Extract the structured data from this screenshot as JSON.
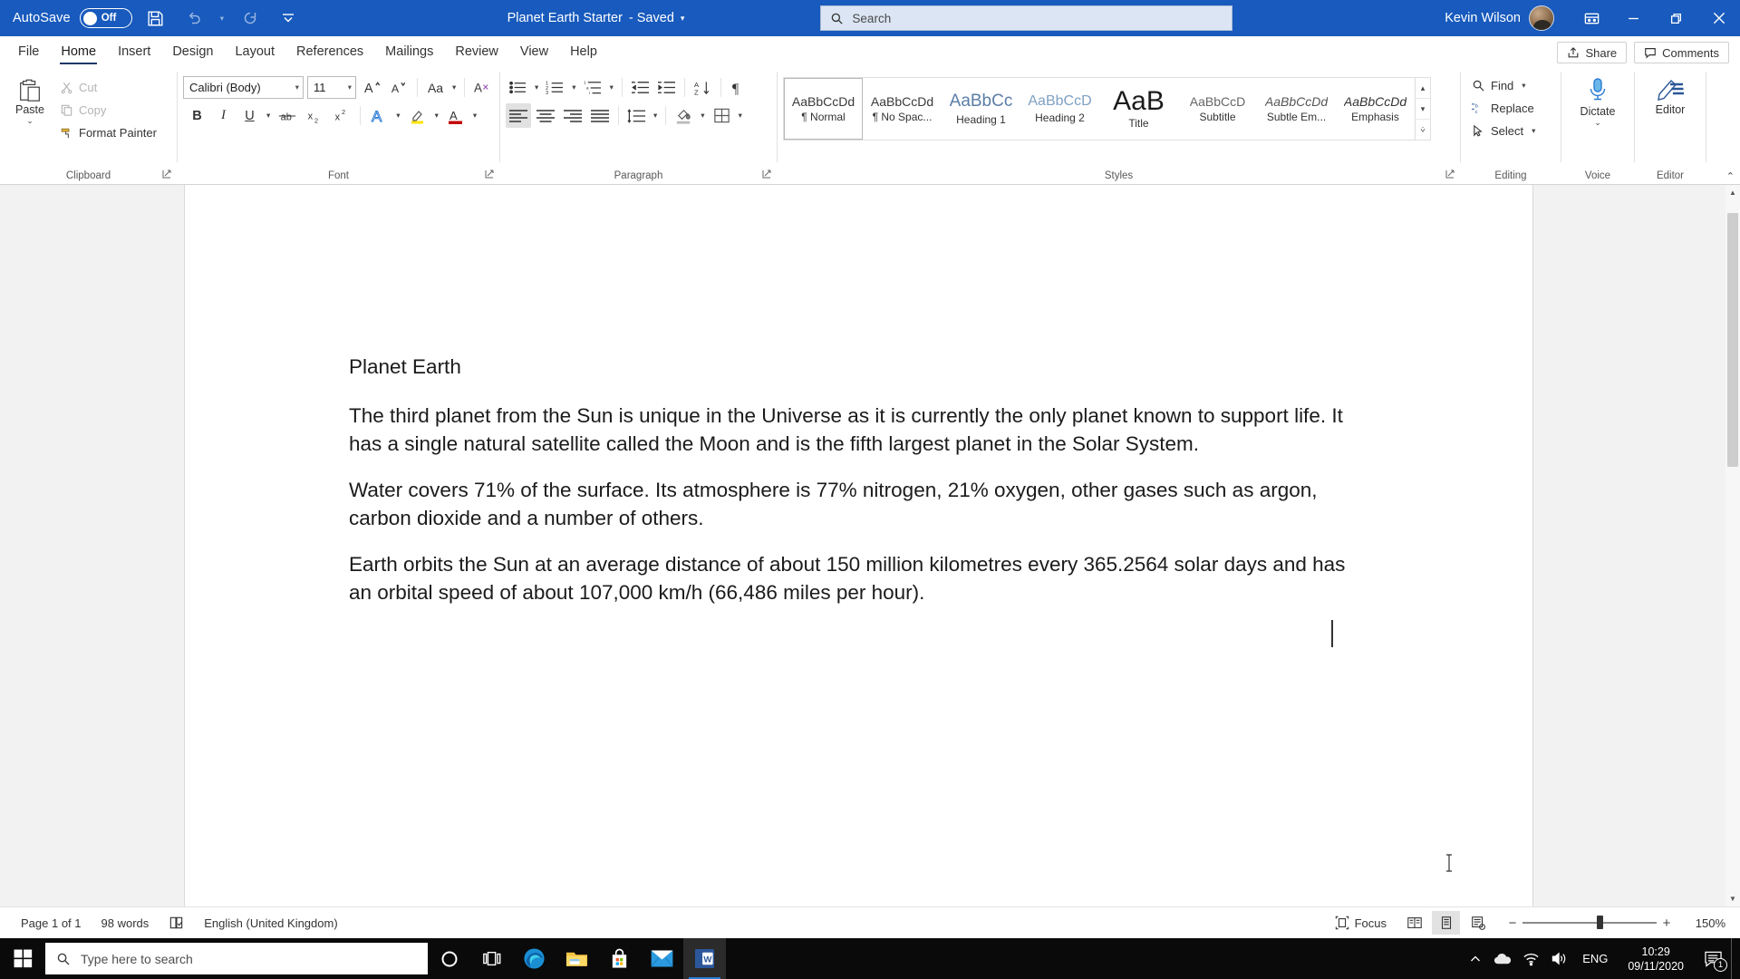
{
  "titlebar": {
    "autosave_label": "AutoSave",
    "autosave_state": "Off",
    "save_icon": "save-icon",
    "undo_icon": "undo-icon",
    "redo_icon": "redo-icon",
    "customize_qat_icon": "customize-quick-access-toolbar-icon",
    "document_title": "Planet Earth Starter",
    "document_status": "- Saved",
    "title_caret_icon": "chevron-down-icon",
    "user_name": "Kevin Wilson",
    "ribbon_display_icon": "ribbon-display-options-icon",
    "minimize_icon": "minimize-icon",
    "restore_icon": "restore-icon",
    "close_icon": "close-icon",
    "accent_color": "#185ABD"
  },
  "search": {
    "placeholder": "Search",
    "icon": "search-icon",
    "value": ""
  },
  "tabs": [
    {
      "label": "File",
      "active": false
    },
    {
      "label": "Home",
      "active": true
    },
    {
      "label": "Insert",
      "active": false
    },
    {
      "label": "Design",
      "active": false
    },
    {
      "label": "Layout",
      "active": false
    },
    {
      "label": "References",
      "active": false
    },
    {
      "label": "Mailings",
      "active": false
    },
    {
      "label": "Review",
      "active": false
    },
    {
      "label": "View",
      "active": false
    },
    {
      "label": "Help",
      "active": false
    }
  ],
  "tabstrip_right": {
    "share_label": "Share",
    "share_icon": "share-icon",
    "comments_label": "Comments",
    "comments_icon": "comment-icon"
  },
  "ribbon": {
    "clipboard": {
      "group_label": "Clipboard",
      "paste_label": "Paste",
      "paste_icon": "paste-icon",
      "cut_label": "Cut",
      "cut_icon": "scissors-icon",
      "copy_label": "Copy",
      "copy_icon": "copy-icon",
      "format_painter_label": "Format Painter",
      "format_painter_icon": "format-painter-icon",
      "dialog_launcher_icon": "dialog-launcher-icon"
    },
    "font": {
      "group_label": "Font",
      "font_name": "Calibri (Body)",
      "font_size": "11",
      "grow_font_icon": "grow-font-icon",
      "shrink_font_icon": "shrink-font-icon",
      "change_case_label": "Aa",
      "change_case_icon": "change-case-icon",
      "clear_formatting_icon": "clear-formatting-icon",
      "bold_label": "B",
      "italic_label": "I",
      "underline_label": "U",
      "strikethrough_icon": "strikethrough-icon",
      "subscript_label": "x",
      "superscript_label": "x",
      "text_effects_icon": "text-effects-icon",
      "highlight_icon": "text-highlight-color-icon",
      "font_color_icon": "font-color-icon",
      "dialog_launcher_icon": "dialog-launcher-icon"
    },
    "paragraph": {
      "group_label": "Paragraph",
      "bullets_icon": "bullets-icon",
      "numbering_icon": "numbering-icon",
      "multilevel_icon": "multilevel-list-icon",
      "decrease_indent_icon": "decrease-indent-icon",
      "increase_indent_icon": "increase-indent-icon",
      "sort_icon": "sort-icon",
      "show_marks_icon": "show-formatting-marks-icon",
      "align_left_icon": "align-left-icon",
      "align_center_icon": "align-center-icon",
      "align_right_icon": "align-right-icon",
      "justify_icon": "justify-icon",
      "line_spacing_icon": "line-spacing-icon",
      "shading_icon": "shading-icon",
      "borders_icon": "borders-icon",
      "dialog_launcher_icon": "dialog-launcher-icon"
    },
    "styles": {
      "group_label": "Styles",
      "dialog_launcher_icon": "dialog-launcher-icon",
      "scroll_up_icon": "chevron-up-icon",
      "scroll_down_icon": "chevron-down-icon",
      "more_icon": "more-styles-icon",
      "items": [
        {
          "preview": "AaBbCcDd",
          "name": "¶ Normal",
          "selected": true,
          "size": "14px",
          "color": "#3a3a3a",
          "style": "normal",
          "weight": "normal"
        },
        {
          "preview": "AaBbCcDd",
          "name": "¶ No Spac...",
          "selected": false,
          "size": "14px",
          "color": "#3a3a3a",
          "style": "normal",
          "weight": "normal"
        },
        {
          "preview": "AaBbCc",
          "name": "Heading 1",
          "selected": false,
          "size": "19px",
          "color": "#5b7da6",
          "style": "normal",
          "weight": "normal"
        },
        {
          "preview": "AaBbCcD",
          "name": "Heading 2",
          "selected": false,
          "size": "16px",
          "color": "#7fa0c2",
          "style": "normal",
          "weight": "normal"
        },
        {
          "preview": "AaB",
          "name": "Title",
          "selected": false,
          "size": "30px",
          "color": "#1b1b1b",
          "style": "normal",
          "weight": "normal"
        },
        {
          "preview": "AaBbCcD",
          "name": "Subtitle",
          "selected": false,
          "size": "14px",
          "color": "#666666",
          "style": "normal",
          "weight": "normal"
        },
        {
          "preview": "AaBbCcDd",
          "name": "Subtle Em...",
          "selected": false,
          "size": "14px",
          "color": "#555555",
          "style": "italic",
          "weight": "normal"
        },
        {
          "preview": "AaBbCcDd",
          "name": "Emphasis",
          "selected": false,
          "size": "14px",
          "color": "#333333",
          "style": "italic",
          "weight": "normal"
        }
      ]
    },
    "editing": {
      "group_label": "Editing",
      "find_label": "Find",
      "find_icon": "search-icon",
      "replace_label": "Replace",
      "replace_icon": "replace-icon",
      "select_label": "Select",
      "select_icon": "select-cursor-icon"
    },
    "voice": {
      "group_label": "Voice",
      "dictate_label": "Dictate",
      "dictate_icon": "microphone-icon"
    },
    "editor": {
      "group_label": "Editor",
      "editor_label": "Editor",
      "editor_icon": "editor-pen-icon"
    },
    "collapse_icon": "collapse-ribbon-icon"
  },
  "document": {
    "heading": "Planet Earth",
    "paragraphs": [
      "The third planet from the Sun is unique in the Universe as it is currently the only planet known to support life. It has a single natural satellite called the Moon and is the fifth largest planet in the Solar System.",
      "Water covers 71% of the surface. Its atmosphere is 77% nitrogen, 21% oxygen, other gases such as argon, carbon dioxide and a number of others.",
      "Earth orbits the Sun at an average distance of about 150 million kilometres every 365.2564 solar days and has an orbital speed of about 107,000 km/h (66,486 miles per hour)."
    ]
  },
  "statusbar": {
    "page_info": "Page 1 of 1",
    "word_count": "98 words",
    "proofing_icon": "proofing-errors-icon",
    "language": "English (United Kingdom)",
    "focus_label": "Focus",
    "focus_icon": "focus-mode-icon",
    "read_mode_icon": "read-mode-icon",
    "print_layout_icon": "print-layout-icon",
    "web_layout_icon": "web-layout-icon",
    "zoom_out_icon": "zoom-out-icon",
    "zoom_in_icon": "zoom-in-icon",
    "zoom_level": "150%"
  },
  "taskbar": {
    "start_icon": "windows-start-icon",
    "search_placeholder": "Type here to search",
    "search_icon": "search-icon",
    "apps": [
      {
        "name": "cortana-icon",
        "active": false
      },
      {
        "name": "task-view-icon",
        "active": false
      },
      {
        "name": "microsoft-edge-icon",
        "active": false
      },
      {
        "name": "file-explorer-icon",
        "active": false
      },
      {
        "name": "microsoft-store-icon",
        "active": false
      },
      {
        "name": "mail-icon",
        "active": false
      },
      {
        "name": "microsoft-word-icon",
        "active": true
      }
    ],
    "tray": {
      "show_hidden_icon": "chevron-up-icon",
      "onedrive_icon": "onedrive-cloud-icon",
      "network_icon": "wifi-icon",
      "volume_icon": "speaker-icon",
      "language": "ENG",
      "time": "10:29",
      "date": "09/11/2020",
      "notification_icon": "notification-icon",
      "notification_count": "1"
    }
  }
}
